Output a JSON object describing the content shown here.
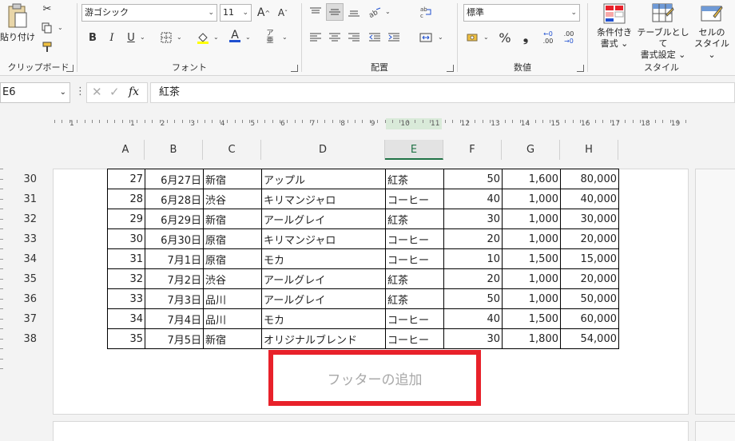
{
  "ribbon": {
    "clipboard": {
      "label": "クリップボード",
      "paste_label": "貼り付け",
      "paste_dd": "⌄"
    },
    "font": {
      "label": "フォント",
      "font_name": "游ゴシック",
      "font_size": "11",
      "bold": "B",
      "italic": "I",
      "underline": "U",
      "grow": "A^",
      "shrink": "Aˇ"
    },
    "alignment": {
      "label": "配置"
    },
    "number": {
      "label": "数値",
      "format": "標準",
      "percent": "%",
      "comma": "❟",
      "inc_decimal": ".00",
      "dec_decimal": ".00"
    },
    "styles": {
      "label": "スタイル",
      "conditional_line1": "条件付き",
      "conditional_line2": "書式",
      "table_line1": "テーブルとして",
      "table_line2": "書式設定",
      "cell_line1": "セルの",
      "cell_line2": "スタイル"
    }
  },
  "formula_bar": {
    "name_box": "E6",
    "fx": "fx",
    "content": "紅茶"
  },
  "ruler": {
    "numbers": [
      "1",
      "1",
      "2",
      "3",
      "4",
      "5",
      "6",
      "7",
      "8",
      "9",
      "10",
      "11",
      "12",
      "13",
      "14",
      "15",
      "16",
      "17",
      "18",
      "19"
    ]
  },
  "columns": [
    "A",
    "B",
    "C",
    "D",
    "E",
    "F",
    "G",
    "H"
  ],
  "selected_column": "E",
  "rows": [
    {
      "n": "30",
      "cells": [
        "27",
        "6月27日",
        "新宿",
        "アップル",
        "紅茶",
        "50",
        "1,600",
        "80,000"
      ]
    },
    {
      "n": "31",
      "cells": [
        "28",
        "6月28日",
        "渋谷",
        "キリマンジャロ",
        "コーヒー",
        "40",
        "1,000",
        "40,000"
      ]
    },
    {
      "n": "32",
      "cells": [
        "29",
        "6月29日",
        "新宿",
        "アールグレイ",
        "紅茶",
        "30",
        "1,000",
        "30,000"
      ]
    },
    {
      "n": "33",
      "cells": [
        "30",
        "6月30日",
        "原宿",
        "キリマンジャロ",
        "コーヒー",
        "20",
        "1,000",
        "20,000"
      ]
    },
    {
      "n": "34",
      "cells": [
        "31",
        "7月1日",
        "原宿",
        "モカ",
        "コーヒー",
        "10",
        "1,500",
        "15,000"
      ]
    },
    {
      "n": "35",
      "cells": [
        "32",
        "7月2日",
        "渋谷",
        "アールグレイ",
        "紅茶",
        "20",
        "1,000",
        "20,000"
      ]
    },
    {
      "n": "36",
      "cells": [
        "33",
        "7月3日",
        "品川",
        "アールグレイ",
        "紅茶",
        "50",
        "1,000",
        "50,000"
      ]
    },
    {
      "n": "37",
      "cells": [
        "34",
        "7月4日",
        "品川",
        "モカ",
        "コーヒー",
        "40",
        "1,500",
        "60,000"
      ]
    },
    {
      "n": "38",
      "cells": [
        "35",
        "7月5日",
        "新宿",
        "オリジナルブレンド",
        "コーヒー",
        "30",
        "1,800",
        "54,000"
      ]
    }
  ],
  "footer": {
    "placeholder": "フッターの追加",
    "highlight_color": "#e8212a"
  },
  "colors": {
    "accent": "#217346"
  }
}
